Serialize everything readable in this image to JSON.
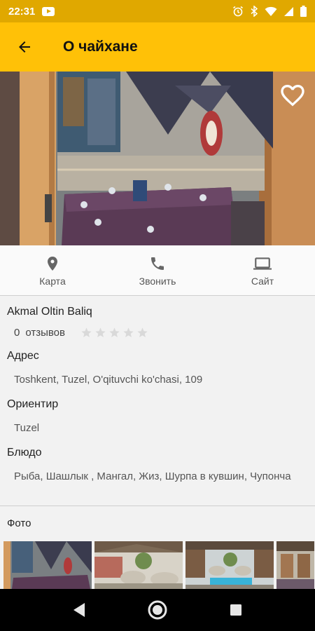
{
  "status": {
    "time": "22:31",
    "icons": [
      "youtube-icon",
      "alarm-icon",
      "bluetooth-icon",
      "wifi-icon",
      "cell-signal-icon",
      "battery-icon"
    ]
  },
  "appbar": {
    "title": "О чайхане",
    "back_icon": "arrow-back-icon"
  },
  "hero": {
    "favorite_icon": "heart-outline-icon"
  },
  "actions": [
    {
      "label": "Карта",
      "icon": "location-pin-icon"
    },
    {
      "label": "Звонить",
      "icon": "phone-icon"
    },
    {
      "label": "Сайт",
      "icon": "laptop-icon"
    }
  ],
  "place": {
    "name": "Akmal Oltin Baliq",
    "reviews_count": "0",
    "reviews_label": "отзывов",
    "rating": 0,
    "rating_max": 5
  },
  "fields": {
    "address_label": "Адрес",
    "address_value": "Toshkent, Tuzel, O'qituvchi ko'chasi, 109",
    "landmark_label": "Ориентир",
    "landmark_value": "Tuzel",
    "dishes_label": "Блюдо",
    "dishes_value": "Рыба, Шашлык , Мангал, Жиз, Шурпа в кувшин, Чупонча"
  },
  "photos": {
    "label": "Фото",
    "count_visible": 4
  },
  "colors": {
    "primary": "#ffc107",
    "status": "#e0a800"
  }
}
